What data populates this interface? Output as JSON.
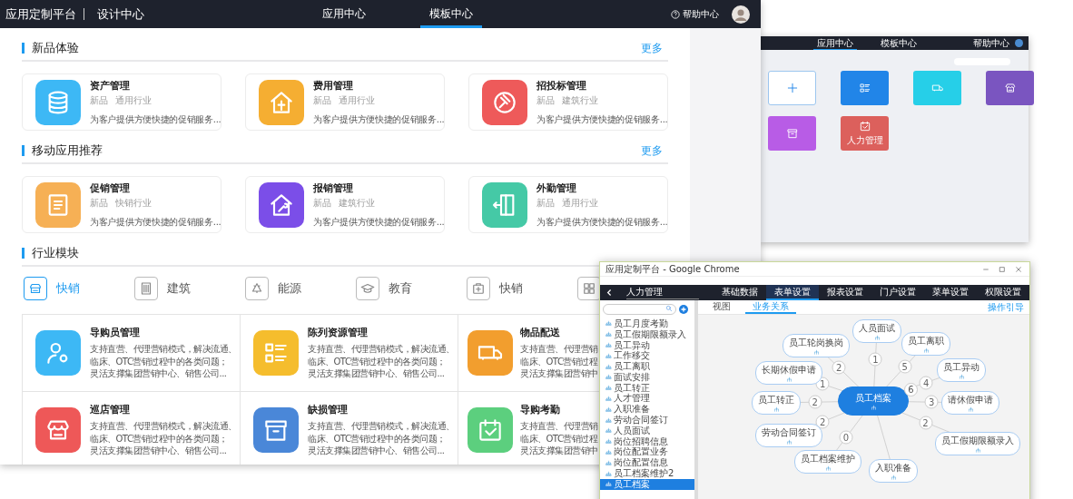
{
  "top_bar": {
    "brand": "应用定制平台",
    "subtitle": "设计中心",
    "nav": [
      {
        "label": "应用中心",
        "selected": false
      },
      {
        "label": "模板中心",
        "selected": true
      }
    ],
    "help": "帮助中心"
  },
  "sections": [
    {
      "title": "新品体验",
      "more": "更多",
      "cards": [
        {
          "title": "资产管理",
          "tags": [
            "新品",
            "通用行业"
          ],
          "description": "为客户提供方便快捷的促销服务...",
          "color": "#3db8f5"
        },
        {
          "title": "费用管理",
          "tags": [
            "新品",
            "通用行业"
          ],
          "description": "为客户提供方便快捷的促销服务...",
          "color": "#f5ae32"
        },
        {
          "title": "招投标管理",
          "tags": [
            "新品",
            "建筑行业"
          ],
          "description": "为客户提供方便快捷的促销服务...",
          "color": "#ee5a5a"
        }
      ]
    },
    {
      "title": "移动应用推荐",
      "more": "更多",
      "cards": [
        {
          "title": "促销管理",
          "tags": [
            "新品",
            "快销行业"
          ],
          "description": "为客户提供方便快捷的促销服务...",
          "color": "#f6b055"
        },
        {
          "title": "报销管理",
          "tags": [
            "新品",
            "建筑行业"
          ],
          "description": "为客户提供方便快捷的促销服务...",
          "color": "#7b4ee8"
        },
        {
          "title": "外勤管理",
          "tags": [
            "新品",
            "通用行业"
          ],
          "description": "为客户提供方便快捷的促销服务...",
          "color": "#45c9a6"
        }
      ]
    }
  ],
  "industry": {
    "title": "行业模块",
    "tabs": [
      {
        "label": "快销",
        "selected": true
      },
      {
        "label": "建筑",
        "selected": false
      },
      {
        "label": "能源",
        "selected": false
      },
      {
        "label": "教育",
        "selected": false
      },
      {
        "label": "快销",
        "selected": false
      },
      {
        "selected": false
      }
    ],
    "modules": [
      {
        "title": "导购员管理",
        "lines": [
          "支持直营、代理营销模式，解决流通、",
          "临床、OTC营销过程中的各类问题；",
          "灵活支撑集团营销中心、销售公司..."
        ],
        "color": "#3db8f5"
      },
      {
        "title": "陈列资源管理",
        "lines": [
          "支持直营、代理营销模式，解决流通、",
          "临床、OTC营销过程中的各类问题；",
          "灵活支撑集团营销中心、销售公司..."
        ],
        "color": "#f5bd2d"
      },
      {
        "title": "物品配送",
        "lines": [
          "支持直营、代理营销",
          "临床、OTC营销过程",
          "灵活支撑集团营销中"
        ],
        "color": "#f29e2e"
      },
      {
        "title": "巡店管理",
        "lines": [
          "支持直营、代理营销模式，解决流通、",
          "临床、OTC营销过程中的各类问题；",
          "灵活支撑集团营销中心、销售公司..."
        ],
        "color": "#ee5858"
      },
      {
        "title": "缺损管理",
        "lines": [
          "支持直营、代理营销模式，解决流通、",
          "临床、OTC营销过程中的各类问题；",
          "灵活支撑集团营销中心、销售公司..."
        ],
        "color": "#4a87d8"
      },
      {
        "title": "导购考勤",
        "lines": [
          "支持直营、代理营销",
          "临床、OTC营销过程",
          "灵活支撑集团营销中"
        ],
        "color": "#5ccf7e"
      }
    ]
  },
  "inset_apps": {
    "nav": [
      {
        "label": "应用中心",
        "selected": true
      },
      {
        "label": "模板中心",
        "selected": false
      }
    ],
    "help": "帮助中心",
    "tiles": [
      {
        "kind": "add"
      },
      {
        "kind": "app",
        "color": "#2185e8"
      },
      {
        "kind": "app",
        "color": "#26cfe8"
      },
      {
        "kind": "app",
        "color": "#7a55c0"
      },
      {
        "kind": "app",
        "color": "#b85ce6"
      },
      {
        "kind": "app",
        "color": "#dc605c",
        "label": "人力管理"
      }
    ]
  },
  "inset_designer": {
    "window_title": "应用定制平台 - Google Chrome",
    "app_name": "人力管理",
    "tabs": [
      {
        "label": "基础数据",
        "selected": false
      },
      {
        "label": "表单设置",
        "selected": true
      },
      {
        "label": "报表设置",
        "selected": false
      },
      {
        "label": "门户设置",
        "selected": false
      },
      {
        "label": "菜单设置",
        "selected": false
      },
      {
        "label": "权限设置",
        "selected": false
      }
    ],
    "subtabs": [
      {
        "label": "视图",
        "selected": false
      },
      {
        "label": "业务关系",
        "selected": true
      }
    ],
    "guide": "操作引导",
    "tree": [
      {
        "label": "员工月度考勤",
        "selected": false
      },
      {
        "label": "员工假期限额录入",
        "selected": false
      },
      {
        "label": "员工异动",
        "selected": false
      },
      {
        "label": "工作移交",
        "selected": false
      },
      {
        "label": "员工离职",
        "selected": false
      },
      {
        "label": "面试安排",
        "selected": false
      },
      {
        "label": "员工转正",
        "selected": false
      },
      {
        "label": "人才管理",
        "selected": false
      },
      {
        "label": "入职准备",
        "selected": false
      },
      {
        "label": "劳动合同签订",
        "selected": false
      },
      {
        "label": "人员面试",
        "selected": false
      },
      {
        "label": "岗位招聘信息",
        "selected": false
      },
      {
        "label": "岗位配置业务",
        "selected": false
      },
      {
        "label": "岗位配置信息",
        "selected": false
      },
      {
        "label": "员工档案维护2",
        "selected": false
      },
      {
        "label": "员工档案",
        "selected": true
      }
    ],
    "diagram": {
      "center": "员工档案",
      "center_count": "6",
      "nodes": [
        {
          "label": "人员面试",
          "edge_label": "1"
        },
        {
          "label": "员工轮岗换岗",
          "edge_label": "2"
        },
        {
          "label": "员工离职",
          "edge_label": "5"
        },
        {
          "label": "员工异动",
          "edge_label": "4"
        },
        {
          "label": "请休假申请",
          "edge_label": "3"
        },
        {
          "label": "员工假期限额录入",
          "edge_label": "2"
        },
        {
          "label": "长期休假申请",
          "edge_label": "1"
        },
        {
          "label": "员工转正",
          "edge_label": "2"
        },
        {
          "label": "劳动合同签订",
          "edge_label": "2"
        },
        {
          "label": "员工档案维护",
          "edge_label": "0"
        },
        {
          "label": "入职准备"
        }
      ]
    }
  }
}
